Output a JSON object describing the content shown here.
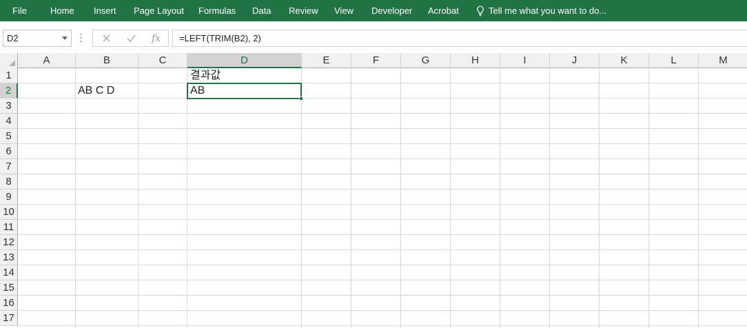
{
  "ribbon": {
    "tabs": [
      "File",
      "Home",
      "Insert",
      "Page Layout",
      "Formulas",
      "Data",
      "Review",
      "View",
      "Developer",
      "Acrobat"
    ],
    "tell_me": "Tell me what you want to do...",
    "icon": "lightbulb-icon"
  },
  "formula_bar": {
    "name_box": "D2",
    "cancel_icon": "cancel-x-icon",
    "enter_icon": "check-icon",
    "function_icon": "fx",
    "formula": "=LEFT(TRIM(B2), 2)"
  },
  "sheet": {
    "columns": [
      "A",
      "B",
      "C",
      "D",
      "E",
      "F",
      "G",
      "H",
      "I",
      "J",
      "K",
      "L",
      "M"
    ],
    "rows": [
      "1",
      "2",
      "3",
      "4",
      "5",
      "6",
      "7",
      "8",
      "9",
      "10",
      "11",
      "12",
      "13",
      "14",
      "15",
      "16",
      "17"
    ],
    "selected_cell": "D2",
    "cells": {
      "D1": "결과값",
      "B2": "AB C D",
      "D2": "AB"
    }
  },
  "colors": {
    "accent": "#217346",
    "header_bg": "#f0f0f0",
    "gridline": "#dadcdd"
  }
}
